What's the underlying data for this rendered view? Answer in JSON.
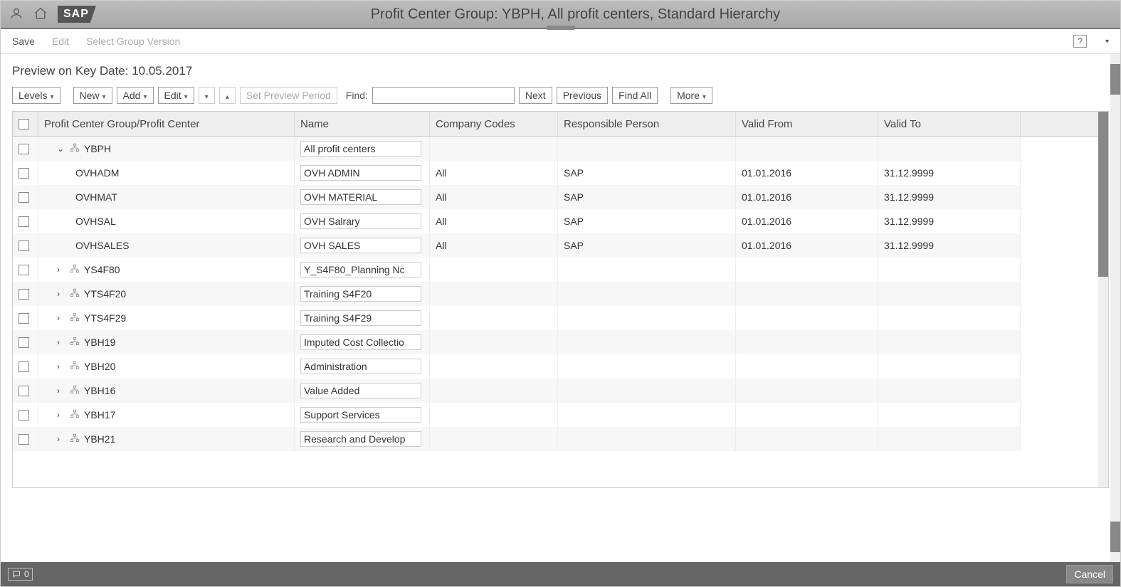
{
  "title": "Profit Center Group: YBPH, All profit centers, Standard Hierarchy",
  "logo_text": "SAP",
  "menu": {
    "save": "Save",
    "edit": "Edit",
    "select_version": "Select Group Version"
  },
  "preview_label": "Preview on Key Date: 10.05.2017",
  "toolbar": {
    "levels": "Levels",
    "new": "New",
    "add": "Add",
    "edit": "Edit",
    "set_preview": "Set Preview Period",
    "find_label": "Find:",
    "next": "Next",
    "previous": "Previous",
    "find_all": "Find All",
    "more": "More"
  },
  "columns": {
    "c1": "Profit Center Group/Profit Center",
    "c2": "Name",
    "c3": "Company Codes",
    "c4": "Responsible Person",
    "c5": "Valid From",
    "c6": "Valid To"
  },
  "rows": [
    {
      "type": "group",
      "expander": "v",
      "indent": 1,
      "code": "YBPH",
      "name": "All profit centers",
      "cc": "",
      "rp": "",
      "vf": "",
      "vt": ""
    },
    {
      "type": "leaf",
      "indent": 2,
      "code": "OVHADM",
      "name": "OVH ADMIN",
      "cc": "All",
      "rp": "SAP",
      "vf": "01.01.2016",
      "vt": "31.12.9999"
    },
    {
      "type": "leaf",
      "indent": 2,
      "code": "OVHMAT",
      "name": "OVH MATERIAL",
      "cc": "All",
      "rp": "SAP",
      "vf": "01.01.2016",
      "vt": "31.12.9999"
    },
    {
      "type": "leaf",
      "indent": 2,
      "code": "OVHSAL",
      "name": "OVH Salrary",
      "cc": "All",
      "rp": "SAP",
      "vf": "01.01.2016",
      "vt": "31.12.9999"
    },
    {
      "type": "leaf",
      "indent": 2,
      "code": "OVHSALES",
      "name": "OVH SALES",
      "cc": "All",
      "rp": "SAP",
      "vf": "01.01.2016",
      "vt": "31.12.9999"
    },
    {
      "type": "group",
      "expander": ">",
      "indent": 1,
      "code": "YS4F80",
      "name": "Y_S4F80_Planning Nc",
      "cc": "",
      "rp": "",
      "vf": "",
      "vt": ""
    },
    {
      "type": "group",
      "expander": ">",
      "indent": 1,
      "code": "YTS4F20",
      "name": "Training S4F20",
      "cc": "",
      "rp": "",
      "vf": "",
      "vt": ""
    },
    {
      "type": "group",
      "expander": ">",
      "indent": 1,
      "code": "YTS4F29",
      "name": "Training S4F29",
      "cc": "",
      "rp": "",
      "vf": "",
      "vt": ""
    },
    {
      "type": "group",
      "expander": ">",
      "indent": 1,
      "code": "YBH19",
      "name": "Imputed Cost Collectio",
      "cc": "",
      "rp": "",
      "vf": "",
      "vt": ""
    },
    {
      "type": "group",
      "expander": ">",
      "indent": 1,
      "code": "YBH20",
      "name": "Administration",
      "cc": "",
      "rp": "",
      "vf": "",
      "vt": ""
    },
    {
      "type": "group",
      "expander": ">",
      "indent": 1,
      "code": "YBH16",
      "name": "Value Added",
      "cc": "",
      "rp": "",
      "vf": "",
      "vt": ""
    },
    {
      "type": "group",
      "expander": ">",
      "indent": 1,
      "code": "YBH17",
      "name": "Support Services",
      "cc": "",
      "rp": "",
      "vf": "",
      "vt": ""
    },
    {
      "type": "group",
      "expander": ">",
      "indent": 1,
      "code": "YBH21",
      "name": "Research and Develop",
      "cc": "",
      "rp": "",
      "vf": "",
      "vt": ""
    }
  ],
  "footer": {
    "msg_count": "0",
    "cancel": "Cancel"
  }
}
